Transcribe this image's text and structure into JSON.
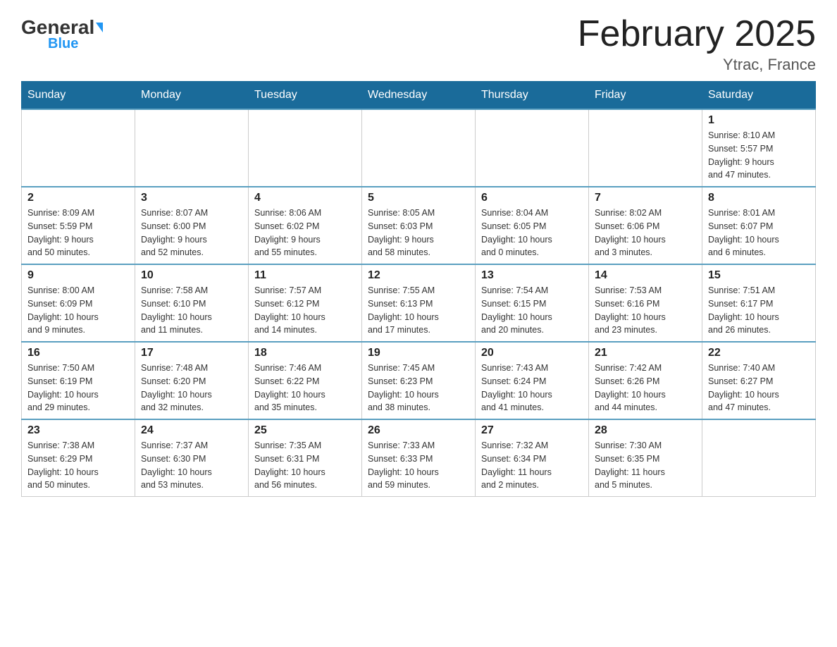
{
  "header": {
    "logo_general": "General",
    "logo_blue": "Blue",
    "month_title": "February 2025",
    "location": "Ytrac, France"
  },
  "days_of_week": [
    "Sunday",
    "Monday",
    "Tuesday",
    "Wednesday",
    "Thursday",
    "Friday",
    "Saturday"
  ],
  "weeks": [
    [
      {
        "day": "",
        "info": ""
      },
      {
        "day": "",
        "info": ""
      },
      {
        "day": "",
        "info": ""
      },
      {
        "day": "",
        "info": ""
      },
      {
        "day": "",
        "info": ""
      },
      {
        "day": "",
        "info": ""
      },
      {
        "day": "1",
        "info": "Sunrise: 8:10 AM\nSunset: 5:57 PM\nDaylight: 9 hours\nand 47 minutes."
      }
    ],
    [
      {
        "day": "2",
        "info": "Sunrise: 8:09 AM\nSunset: 5:59 PM\nDaylight: 9 hours\nand 50 minutes."
      },
      {
        "day": "3",
        "info": "Sunrise: 8:07 AM\nSunset: 6:00 PM\nDaylight: 9 hours\nand 52 minutes."
      },
      {
        "day": "4",
        "info": "Sunrise: 8:06 AM\nSunset: 6:02 PM\nDaylight: 9 hours\nand 55 minutes."
      },
      {
        "day": "5",
        "info": "Sunrise: 8:05 AM\nSunset: 6:03 PM\nDaylight: 9 hours\nand 58 minutes."
      },
      {
        "day": "6",
        "info": "Sunrise: 8:04 AM\nSunset: 6:05 PM\nDaylight: 10 hours\nand 0 minutes."
      },
      {
        "day": "7",
        "info": "Sunrise: 8:02 AM\nSunset: 6:06 PM\nDaylight: 10 hours\nand 3 minutes."
      },
      {
        "day": "8",
        "info": "Sunrise: 8:01 AM\nSunset: 6:07 PM\nDaylight: 10 hours\nand 6 minutes."
      }
    ],
    [
      {
        "day": "9",
        "info": "Sunrise: 8:00 AM\nSunset: 6:09 PM\nDaylight: 10 hours\nand 9 minutes."
      },
      {
        "day": "10",
        "info": "Sunrise: 7:58 AM\nSunset: 6:10 PM\nDaylight: 10 hours\nand 11 minutes."
      },
      {
        "day": "11",
        "info": "Sunrise: 7:57 AM\nSunset: 6:12 PM\nDaylight: 10 hours\nand 14 minutes."
      },
      {
        "day": "12",
        "info": "Sunrise: 7:55 AM\nSunset: 6:13 PM\nDaylight: 10 hours\nand 17 minutes."
      },
      {
        "day": "13",
        "info": "Sunrise: 7:54 AM\nSunset: 6:15 PM\nDaylight: 10 hours\nand 20 minutes."
      },
      {
        "day": "14",
        "info": "Sunrise: 7:53 AM\nSunset: 6:16 PM\nDaylight: 10 hours\nand 23 minutes."
      },
      {
        "day": "15",
        "info": "Sunrise: 7:51 AM\nSunset: 6:17 PM\nDaylight: 10 hours\nand 26 minutes."
      }
    ],
    [
      {
        "day": "16",
        "info": "Sunrise: 7:50 AM\nSunset: 6:19 PM\nDaylight: 10 hours\nand 29 minutes."
      },
      {
        "day": "17",
        "info": "Sunrise: 7:48 AM\nSunset: 6:20 PM\nDaylight: 10 hours\nand 32 minutes."
      },
      {
        "day": "18",
        "info": "Sunrise: 7:46 AM\nSunset: 6:22 PM\nDaylight: 10 hours\nand 35 minutes."
      },
      {
        "day": "19",
        "info": "Sunrise: 7:45 AM\nSunset: 6:23 PM\nDaylight: 10 hours\nand 38 minutes."
      },
      {
        "day": "20",
        "info": "Sunrise: 7:43 AM\nSunset: 6:24 PM\nDaylight: 10 hours\nand 41 minutes."
      },
      {
        "day": "21",
        "info": "Sunrise: 7:42 AM\nSunset: 6:26 PM\nDaylight: 10 hours\nand 44 minutes."
      },
      {
        "day": "22",
        "info": "Sunrise: 7:40 AM\nSunset: 6:27 PM\nDaylight: 10 hours\nand 47 minutes."
      }
    ],
    [
      {
        "day": "23",
        "info": "Sunrise: 7:38 AM\nSunset: 6:29 PM\nDaylight: 10 hours\nand 50 minutes."
      },
      {
        "day": "24",
        "info": "Sunrise: 7:37 AM\nSunset: 6:30 PM\nDaylight: 10 hours\nand 53 minutes."
      },
      {
        "day": "25",
        "info": "Sunrise: 7:35 AM\nSunset: 6:31 PM\nDaylight: 10 hours\nand 56 minutes."
      },
      {
        "day": "26",
        "info": "Sunrise: 7:33 AM\nSunset: 6:33 PM\nDaylight: 10 hours\nand 59 minutes."
      },
      {
        "day": "27",
        "info": "Sunrise: 7:32 AM\nSunset: 6:34 PM\nDaylight: 11 hours\nand 2 minutes."
      },
      {
        "day": "28",
        "info": "Sunrise: 7:30 AM\nSunset: 6:35 PM\nDaylight: 11 hours\nand 5 minutes."
      },
      {
        "day": "",
        "info": ""
      }
    ]
  ]
}
